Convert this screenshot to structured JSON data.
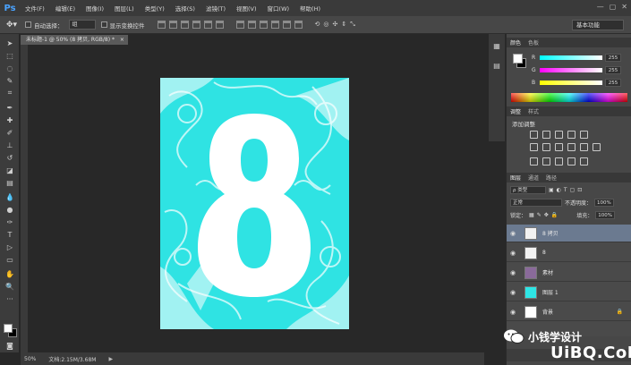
{
  "app": {
    "logo": "Ps"
  },
  "menubar": {
    "items": [
      "文件(F)",
      "编辑(E)",
      "图像(I)",
      "图层(L)",
      "类型(Y)",
      "选择(S)",
      "滤镜(T)",
      "视图(V)",
      "窗口(W)",
      "帮助(H)"
    ],
    "window_controls": [
      "—",
      "▢",
      "✕"
    ]
  },
  "options": {
    "auto_select_label": "自动选择：",
    "auto_select_value": "组",
    "show_transform_label": "显示变换控件",
    "workspace": "基本功能"
  },
  "document": {
    "tab_title": "未标题-1 @ 50% (8 拷贝, RGB/8) *",
    "close": "×",
    "bg_color": "#2ee6e6"
  },
  "status": {
    "zoom": "50%",
    "doc_size": "文档:2.15M/3.68M",
    "arrow": "▶"
  },
  "color_panel": {
    "tabs": [
      "颜色",
      "色板"
    ],
    "channels": [
      {
        "label": "R",
        "value": "255"
      },
      {
        "label": "G",
        "value": "255"
      },
      {
        "label": "B",
        "value": "255"
      }
    ]
  },
  "adjust_panel": {
    "tabs": [
      "调整",
      "样式"
    ],
    "title": "添加调整"
  },
  "layers_panel": {
    "tabs": [
      "图层",
      "通道",
      "路径"
    ],
    "filter": "ρ 类型",
    "blend_mode": "正常",
    "opacity_label": "不透明度：",
    "opacity_value": "100%",
    "lock_label": "锁定：",
    "fill_label": "填充：",
    "fill_value": "100%",
    "layers": [
      {
        "name": "8 拷贝",
        "selected": true,
        "thumb": "#f2f2f2"
      },
      {
        "name": "8",
        "selected": false,
        "thumb": "#f2f2f2"
      },
      {
        "name": "素材",
        "selected": false,
        "thumb": "#8a6a9a"
      },
      {
        "name": "图层 1",
        "selected": false,
        "thumb": "#2ee6e6"
      },
      {
        "name": "背景",
        "selected": false,
        "thumb": "#ffffff"
      }
    ]
  },
  "watermark": {
    "text": "小钱学设计",
    "logo": "UiBQ.CoM"
  }
}
